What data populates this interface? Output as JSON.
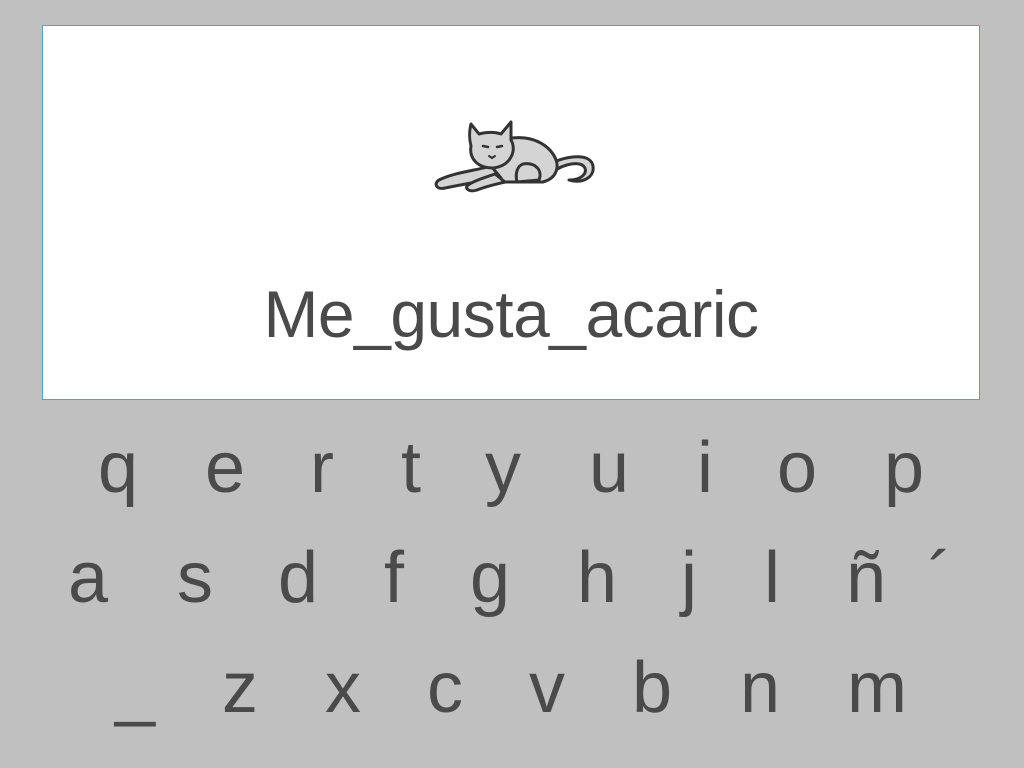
{
  "prompt": {
    "image": "cat-icon",
    "text": "Me_gusta_acaric"
  },
  "keyboard": {
    "row1": [
      "q",
      "e",
      "r",
      "t",
      "y",
      "u",
      "i",
      "o",
      "p"
    ],
    "row2": [
      "a",
      "s",
      "d",
      "f",
      "g",
      "h",
      "j",
      "l",
      "ñ",
      "´"
    ],
    "row3": [
      "_",
      "z",
      "x",
      "c",
      "v",
      "b",
      "n",
      "m"
    ]
  },
  "colors": {
    "background": "#c0c0c0",
    "card": "#ffffff",
    "card_border": "#4aa3d6",
    "text": "#4a4a4a"
  }
}
